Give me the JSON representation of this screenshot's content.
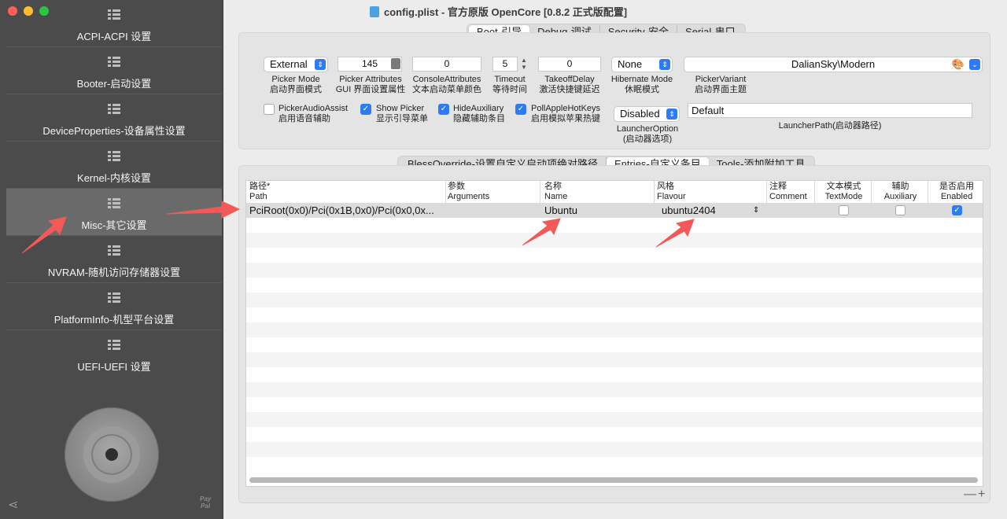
{
  "window": {
    "title": "config.plist - 官方原版 OpenCore [0.8.2 正式版配置]"
  },
  "sidebar": {
    "items": [
      {
        "label": "ACPI-ACPI 设置"
      },
      {
        "label": "Booter-启动设置"
      },
      {
        "label": "DeviceProperties-设备属性设置"
      },
      {
        "label": "Kernel-内核设置"
      },
      {
        "label": "Misc-其它设置",
        "selected": true
      },
      {
        "label": "NVRAM-随机访问存储器设置"
      },
      {
        "label": "PlatformInfo-机型平台设置"
      },
      {
        "label": "UEFI-UEFI 设置"
      }
    ],
    "paypal": "Pay Pal"
  },
  "top_tabs": [
    "Boot-引导",
    "Debug-调试",
    "Security-安全",
    "Serial-串口"
  ],
  "boot": {
    "picker_mode": {
      "value": "External",
      "caption1": "Picker Mode",
      "caption2": "启动界面模式"
    },
    "picker_attributes": {
      "value": "145",
      "caption1": "Picker Attributes",
      "caption2": "GUI 界面设置属性"
    },
    "console_attributes": {
      "value": "0",
      "caption1": "ConsoleAttributes",
      "caption2": "文本启动菜单颜色"
    },
    "timeout": {
      "value": "5",
      "caption1": "Timeout",
      "caption2": "等待时间"
    },
    "takeoff_delay": {
      "value": "0",
      "caption1": "TakeoffDelay",
      "caption2": "激活快捷键延迟"
    },
    "hibernate_mode": {
      "value": "None",
      "caption1": "Hibernate Mode",
      "caption2": "休眠模式"
    },
    "picker_variant": {
      "value": "DalianSky\\Modern",
      "caption1": "PickerVariant",
      "caption2": "启动界面主题"
    },
    "picker_audio_assist": {
      "label1": "PickerAudioAssist",
      "label2": "启用语音辅助",
      "checked": false
    },
    "show_picker": {
      "label1": "Show Picker",
      "label2": "显示引导菜单",
      "checked": true
    },
    "hide_auxiliary": {
      "label1": "HideAuxiliary",
      "label2": "隐藏辅助条目",
      "checked": true
    },
    "poll_apple_hotkeys": {
      "label1": "PollAppleHotKeys",
      "label2": "启用模拟苹果热键",
      "checked": true
    },
    "launcher_option": {
      "value": "Disabled",
      "caption1": "LauncherOption",
      "caption2": "(启动器选项)"
    },
    "launcher_path": {
      "value": "Default",
      "caption": "LauncherPath(启动器路径)"
    }
  },
  "sub_tabs": [
    "BlessOverride-设置自定义启动项绝对路径",
    "Entries-自定义条目",
    "Tools-添加附加工具"
  ],
  "table": {
    "headers": [
      {
        "l1": "路径*",
        "l2": "Path"
      },
      {
        "l1": "参数",
        "l2": "Arguments"
      },
      {
        "l1": "名称",
        "l2": "Name"
      },
      {
        "l1": "风格",
        "l2": "Flavour"
      },
      {
        "l1": "注释",
        "l2": "Comment"
      },
      {
        "l1": "文本模式",
        "l2": "TextMode"
      },
      {
        "l1": "辅助",
        "l2": "Auxiliary"
      },
      {
        "l1": "是否启用",
        "l2": "Enabled"
      }
    ],
    "rows": [
      {
        "path": "PciRoot(0x0)/Pci(0x1B,0x0)/Pci(0x0,0x...",
        "arguments": "",
        "name": "Ubuntu",
        "flavour": "ubuntu2404",
        "comment": "",
        "textmode": false,
        "auxiliary": false,
        "enabled": true
      }
    ]
  },
  "footer": {
    "minus_plus": "—+"
  },
  "colors": {
    "accent": "#2d7cf6",
    "arrow": "#f25a5a",
    "sidebar": "#4b4b4b"
  }
}
